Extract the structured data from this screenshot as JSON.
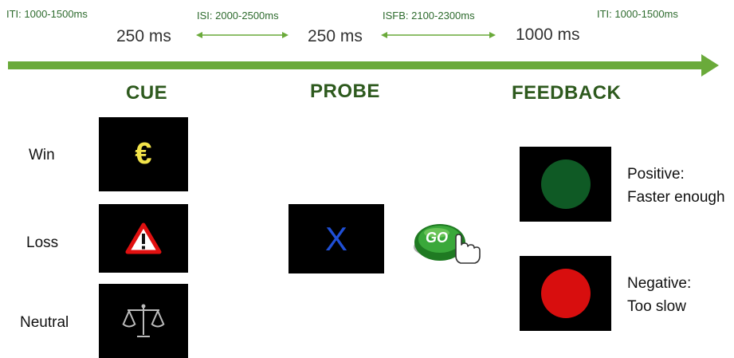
{
  "timeline": {
    "iti_start": "ITI: 1000-1500ms",
    "isi": "ISI: 2000-2500ms",
    "isfb": "ISFB: 2100-2300ms",
    "iti_end": "ITI: 1000-1500ms",
    "cue_duration": "250 ms",
    "probe_duration": "250 ms",
    "feedback_duration": "1000 ms"
  },
  "phases": {
    "cue": "CUE",
    "probe": "PROBE",
    "feedback": "FEEDBACK"
  },
  "conditions": {
    "win": "Win",
    "loss": "Loss",
    "neutral": "Neutral"
  },
  "icons": {
    "win_symbol": "€",
    "probe_symbol": "X",
    "go_text": "GO"
  },
  "feedback": {
    "positive_line1": "Positive:",
    "positive_line2": "Faster enough",
    "negative_line1": "Negative:",
    "negative_line2": "Too slow"
  },
  "colors": {
    "timeline_green": "#6aaa3a",
    "euro_yellow": "#f2e34a",
    "probe_blue": "#1f4fd6",
    "positive_green": "#0f5a25",
    "negative_red": "#d80e0e"
  }
}
